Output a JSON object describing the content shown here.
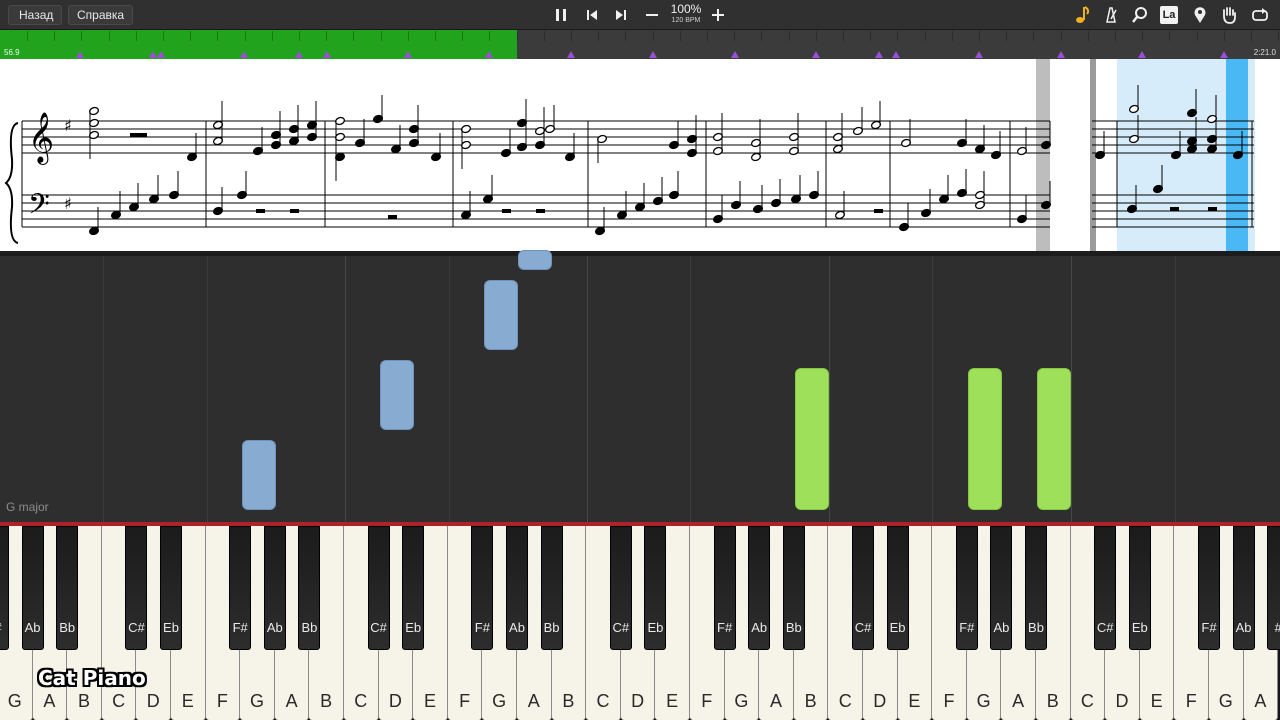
{
  "toolbar": {
    "back_label": "Назад",
    "help_label": "Справка",
    "zoom_percent": "100%",
    "tempo_bpm": "120 BPM",
    "pause_icon": "pause-icon",
    "prev_icon": "skip-back-icon",
    "next_icon": "skip-forward-icon",
    "minus_icon": "minus-icon",
    "plus_icon": "plus-icon",
    "right_icons": [
      "note-icon",
      "metronome-icon",
      "magnifier-icon",
      "la-icon",
      "location-pin-icon",
      "hand-icon",
      "loop-icon"
    ],
    "la_label": "La"
  },
  "timeline": {
    "elapsed": "56.9",
    "total": "2:21.0",
    "progress_fraction": 0.404,
    "progress_color": "#22a31d",
    "marker_color": "#9a4fd6"
  },
  "falling_notes": {
    "key_signature": "G major",
    "blue_color": "#88abd2",
    "green_color": "#9ee05a"
  },
  "keyboard": {
    "white_keys": [
      "G",
      "A",
      "B",
      "C",
      "D",
      "E",
      "F",
      "G",
      "A",
      "B",
      "C",
      "D",
      "E",
      "F",
      "G",
      "A",
      "B",
      "C",
      "D",
      "E",
      "F",
      "G",
      "A",
      "B",
      "C",
      "D",
      "E",
      "F",
      "G",
      "A",
      "B",
      "C",
      "D",
      "E",
      "F",
      "G",
      "A"
    ],
    "black_key_labels": [
      "#",
      "Ab",
      "Bb",
      "C#",
      "Eb",
      "F#",
      "Ab",
      "Bb",
      "C#",
      "Eb",
      "F#",
      "Ab",
      "Bb",
      "C#",
      "Eb",
      "F#",
      "Ab",
      "Bb",
      "C#",
      "Eb",
      "F#",
      "Ab",
      "Bb",
      "C#",
      "Eb",
      "F#",
      "Ab",
      "#"
    ]
  },
  "brand": "Cat Piano"
}
